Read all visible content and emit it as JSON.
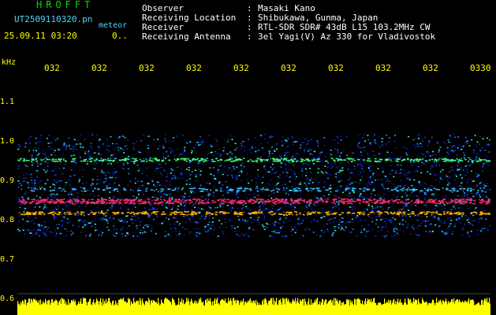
{
  "header": {
    "logo": "HROFFT",
    "filename": "UT2509110320.pn",
    "tag": "meteor",
    "datetime": "25.09.11 03:20",
    "extra": "0..",
    "fields": [
      {
        "label": "Observer",
        "sep": ":",
        "value": "Masaki Kano"
      },
      {
        "label": "Receiving Location",
        "sep": ":",
        "value": "Shibukawa, Gunma, Japan"
      },
      {
        "label": "Receiver",
        "sep": ":",
        "value": "RTL-SDR SDR# 43dB L15 103.2MHz CW"
      },
      {
        "label": "Receiving Antenna",
        "sep": ":",
        "value": "3el Yagi(V) Az 330 for Vladivostok"
      }
    ]
  },
  "chart_data": {
    "type": "heatmap",
    "title": "",
    "ylabel": "kHz",
    "yticks": [
      "1.1",
      "1.0",
      "0.9",
      "0.8",
      "0.7",
      "0.6"
    ],
    "ylim": [
      0.6,
      1.1
    ],
    "xticks": [
      "032",
      "032",
      "032",
      "032",
      "032",
      "032",
      "032",
      "032",
      "032",
      "0330"
    ],
    "bands": [
      {
        "freq_khz": 0.85,
        "intensity": "strong",
        "color": "#ff2a6a"
      },
      {
        "freq_khz": 0.82,
        "intensity": "medium",
        "color": "#ffb000"
      },
      {
        "freq_khz": 0.955,
        "intensity": "medium",
        "color": "#40ff80"
      },
      {
        "freq_khz": 0.88,
        "intensity": "weak",
        "color": "#40c0ff"
      }
    ],
    "noise_range_khz": [
      0.76,
      1.02
    ],
    "bottom_strip_color": "#ffff00",
    "grid": false
  },
  "colors": {
    "background": "#000000",
    "labels": "#ffff00",
    "header_text": "#ffffff",
    "logo": "#00e000",
    "filename": "#4ad7ff"
  }
}
